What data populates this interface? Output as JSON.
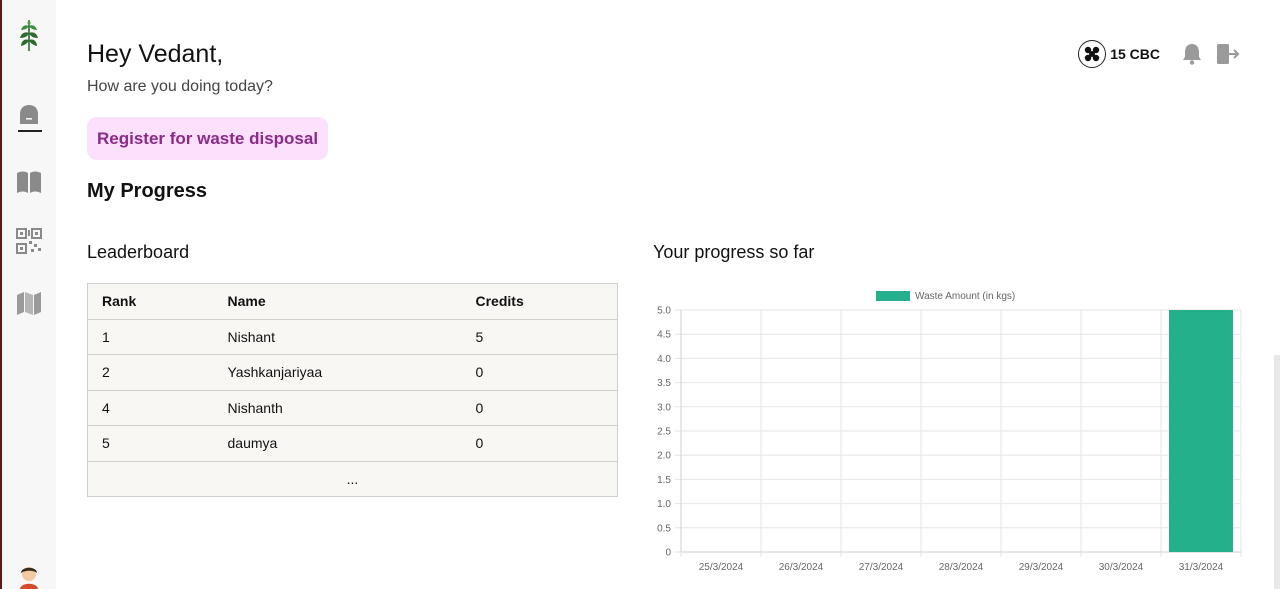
{
  "user": {
    "greeting": "Hey Vedant,",
    "subtitle": "How are you doing today?"
  },
  "header": {
    "credits": "15 CBC"
  },
  "actions": {
    "register_label": "Register for waste disposal"
  },
  "section": {
    "progress_title": "My Progress"
  },
  "leaderboard": {
    "title": "Leaderboard",
    "columns": [
      "Rank",
      "Name",
      "Credits"
    ],
    "rows": [
      {
        "rank": "1",
        "name": "Nishant",
        "credits": "5"
      },
      {
        "rank": "2",
        "name": "Yashkanjariyaa",
        "credits": "0"
      },
      {
        "rank": "4",
        "name": "Nishanth",
        "credits": "0"
      },
      {
        "rank": "5",
        "name": "daumya",
        "credits": "0"
      }
    ],
    "more": "..."
  },
  "progress_chart": {
    "title": "Your progress so far"
  },
  "colors": {
    "bar": "#23b08a",
    "accent_bg": "#fde0fb",
    "accent_text": "#8b2a89",
    "table_bg": "#f8f7f3"
  },
  "icons": [
    "leaf-logo-icon",
    "home-icon",
    "book-icon",
    "qr-code-icon",
    "map-icon",
    "avatar-icon",
    "coin-icon",
    "bell-icon",
    "logout-icon"
  ],
  "chart_data": {
    "type": "bar",
    "categories": [
      "25/3/2024",
      "26/3/2024",
      "27/3/2024",
      "28/3/2024",
      "29/3/2024",
      "30/3/2024",
      "31/3/2024"
    ],
    "series": [
      {
        "name": "Waste Amount (in kgs)",
        "values": [
          0,
          0,
          0,
          0,
          0,
          0,
          5
        ]
      }
    ],
    "yticks": [
      "0",
      "0.5",
      "1.0",
      "1.5",
      "2.0",
      "2.5",
      "3.0",
      "3.5",
      "4.0",
      "4.5",
      "5.0"
    ],
    "ylim": [
      0,
      5
    ],
    "grid": true,
    "legend": "top-center"
  }
}
